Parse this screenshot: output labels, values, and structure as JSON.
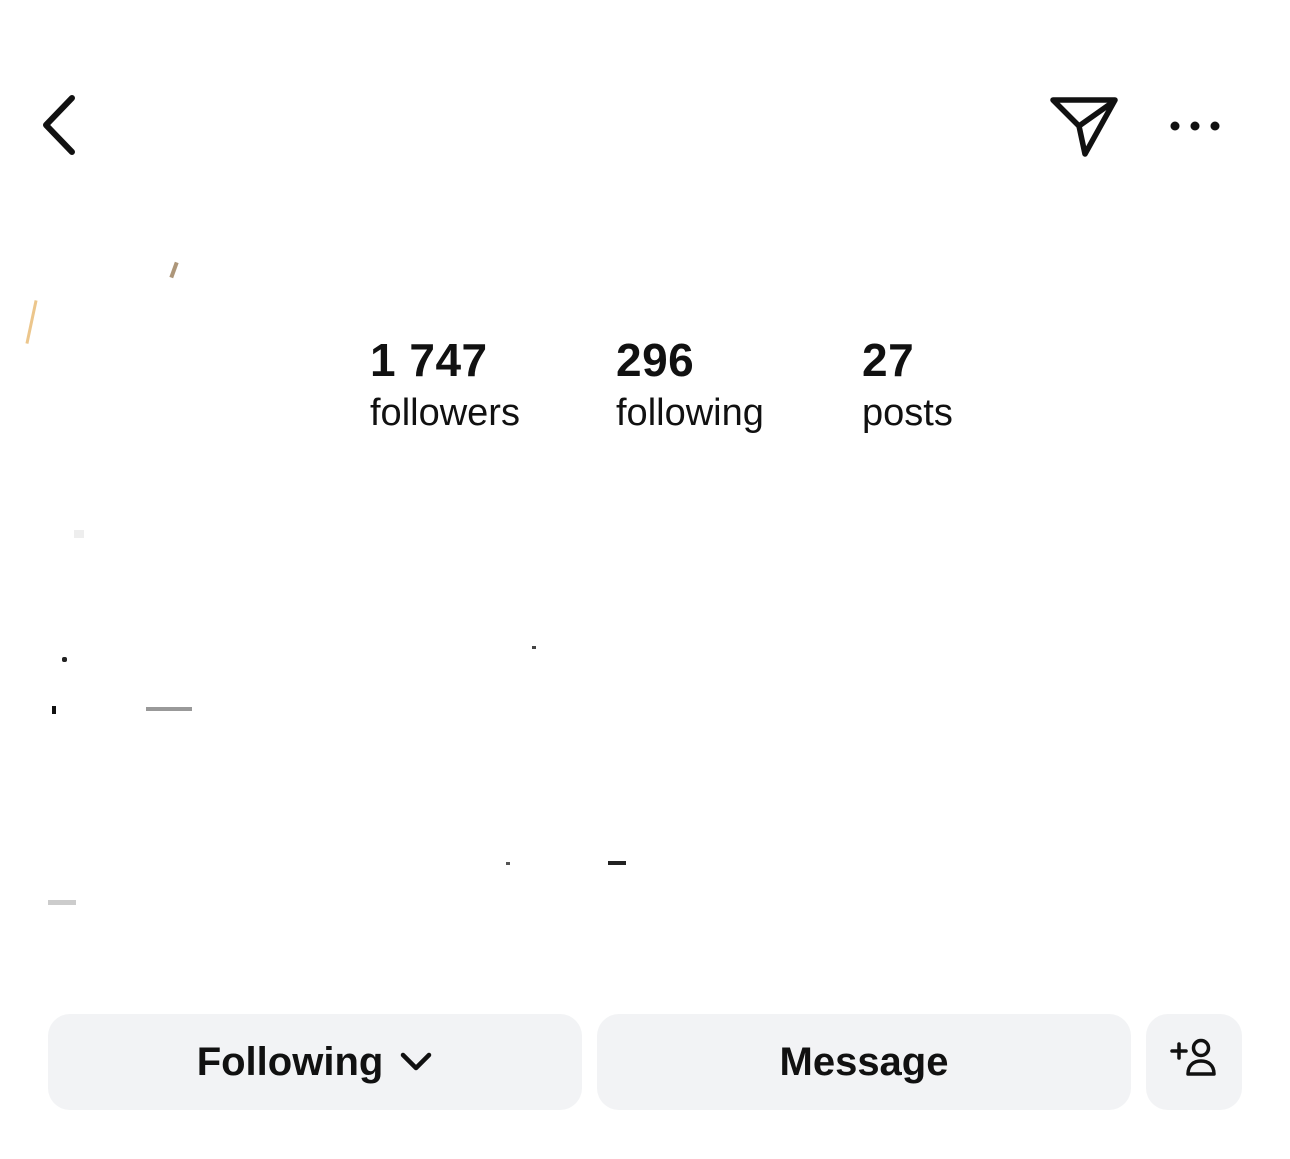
{
  "header": {
    "back_icon": "chevron-left-icon",
    "send_icon": "paper-plane-icon",
    "more_icon": "ellipsis-icon"
  },
  "stats": [
    {
      "value": "1 747",
      "label": "followers"
    },
    {
      "value": "296",
      "label": "following"
    },
    {
      "value": "27",
      "label": "posts"
    }
  ],
  "actions": {
    "following_label": "Following",
    "following_icon": "chevron-down-icon",
    "message_label": "Message",
    "add_person_icon": "add-person-icon"
  }
}
